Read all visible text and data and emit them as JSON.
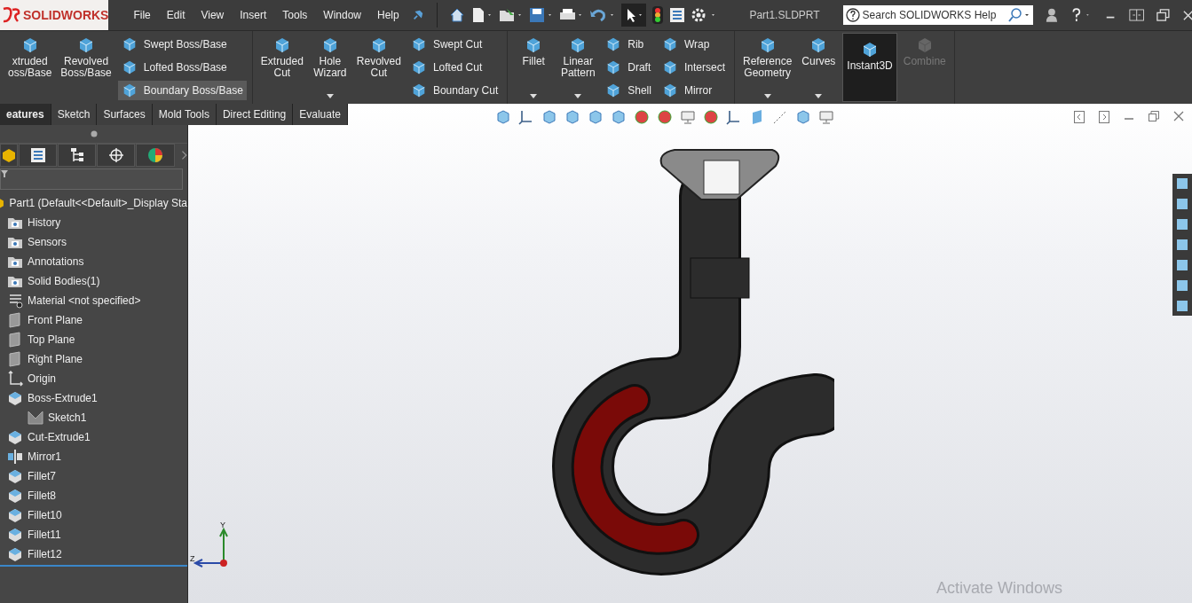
{
  "title_bar": {
    "logo": "SOLIDWORKS",
    "menus": [
      "File",
      "Edit",
      "View",
      "Insert",
      "Tools",
      "Window",
      "Help"
    ],
    "document": "Part1.SLDPRT",
    "search": {
      "placeholder": "Search SOLIDWORKS Help"
    }
  },
  "ribbon": {
    "groups": [
      {
        "columns": [
          {
            "kind": "large",
            "lines": [
              "xtruded",
              "oss/Base"
            ],
            "dropdown": false,
            "active": false,
            "disabled": false
          },
          {
            "kind": "large",
            "lines": [
              "Revolved",
              "Boss/Base"
            ],
            "dropdown": false,
            "active": false,
            "disabled": false
          },
          {
            "kind": "stack",
            "items": [
              {
                "label": "Swept Boss/Base",
                "highlighted": false
              },
              {
                "label": "Lofted Boss/Base",
                "highlighted": false
              },
              {
                "label": "Boundary Boss/Base",
                "highlighted": true
              }
            ]
          }
        ]
      },
      {
        "columns": [
          {
            "kind": "large",
            "lines": [
              "Extruded",
              "Cut"
            ],
            "dropdown": false,
            "active": false,
            "disabled": false
          },
          {
            "kind": "large",
            "lines": [
              "Hole",
              "Wizard"
            ],
            "dropdown": true,
            "active": false,
            "disabled": false
          },
          {
            "kind": "large",
            "lines": [
              "Revolved",
              "Cut"
            ],
            "dropdown": false,
            "active": false,
            "disabled": false
          },
          {
            "kind": "stack",
            "items": [
              {
                "label": "Swept Cut",
                "highlighted": false
              },
              {
                "label": "Lofted Cut",
                "highlighted": false
              },
              {
                "label": "Boundary Cut",
                "highlighted": false
              }
            ]
          }
        ]
      },
      {
        "columns": [
          {
            "kind": "large",
            "lines": [
              "Fillet"
            ],
            "dropdown": true,
            "active": false,
            "disabled": false
          },
          {
            "kind": "large",
            "lines": [
              "Linear",
              "Pattern"
            ],
            "dropdown": true,
            "active": false,
            "disabled": false
          },
          {
            "kind": "stack",
            "items": [
              {
                "label": "Rib",
                "highlighted": false
              },
              {
                "label": "Draft",
                "highlighted": false
              },
              {
                "label": "Shell",
                "highlighted": false
              }
            ]
          },
          {
            "kind": "stack",
            "items": [
              {
                "label": "Wrap",
                "highlighted": false
              },
              {
                "label": "Intersect",
                "highlighted": false
              },
              {
                "label": "Mirror",
                "highlighted": false
              }
            ]
          }
        ]
      },
      {
        "columns": [
          {
            "kind": "large",
            "lines": [
              "Reference",
              "Geometry"
            ],
            "dropdown": true,
            "active": false,
            "disabled": false
          },
          {
            "kind": "large",
            "lines": [
              "Curves"
            ],
            "dropdown": true,
            "active": false,
            "disabled": false
          },
          {
            "kind": "large",
            "lines": [
              "Instant3D"
            ],
            "dropdown": false,
            "active": true,
            "disabled": false
          },
          {
            "kind": "large",
            "lines": [
              "Combine"
            ],
            "dropdown": false,
            "active": false,
            "disabled": true
          }
        ]
      }
    ]
  },
  "tabs": [
    {
      "label": "eatures",
      "selected": true
    },
    {
      "label": "Sketch",
      "selected": false
    },
    {
      "label": "Surfaces",
      "selected": false
    },
    {
      "label": "Mold Tools",
      "selected": false
    },
    {
      "label": "Direct Editing",
      "selected": false
    },
    {
      "label": "Evaluate",
      "selected": false
    }
  ],
  "feature_tree": {
    "items": [
      {
        "label": "Part1  (Default<<Default>_Display Sta",
        "kind": "part",
        "children": [
          {
            "label": "History",
            "kind": "folder"
          },
          {
            "label": "Sensors",
            "kind": "folder"
          },
          {
            "label": "Annotations",
            "kind": "folder"
          },
          {
            "label": "Solid Bodies(1)",
            "kind": "folder"
          },
          {
            "label": "Material <not specified>",
            "kind": "material"
          },
          {
            "label": "Front Plane",
            "kind": "plane"
          },
          {
            "label": "Top Plane",
            "kind": "plane"
          },
          {
            "label": "Right Plane",
            "kind": "plane"
          },
          {
            "label": "Origin",
            "kind": "origin"
          },
          {
            "label": "Boss-Extrude1",
            "kind": "feature",
            "children": [
              {
                "label": "Sketch1",
                "kind": "sketch"
              }
            ]
          },
          {
            "label": "Cut-Extrude1",
            "kind": "feature"
          },
          {
            "label": "Mirror1",
            "kind": "mirror"
          },
          {
            "label": "Fillet7",
            "kind": "fillet"
          },
          {
            "label": "Fillet8",
            "kind": "fillet"
          },
          {
            "label": "Fillet10",
            "kind": "fillet"
          },
          {
            "label": "Fillet11",
            "kind": "fillet"
          },
          {
            "label": "Fillet12",
            "kind": "fillet"
          }
        ]
      }
    ]
  },
  "viewport": {
    "triad": {
      "y_label": "Y",
      "z_label": "Z"
    },
    "notice": "Activate Windows"
  }
}
